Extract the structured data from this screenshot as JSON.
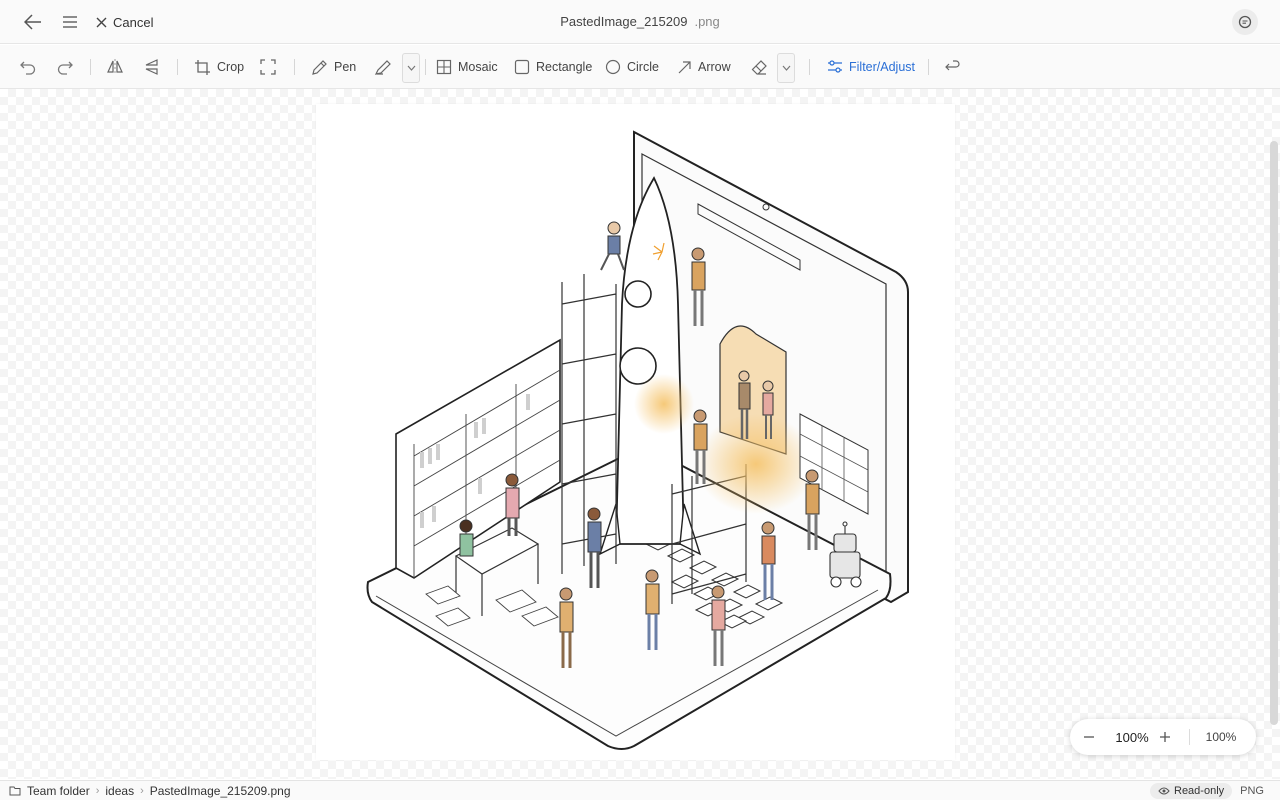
{
  "titlebar": {
    "cancel_label": "Cancel",
    "file_name": "PastedImage_215209",
    "file_ext": ".png"
  },
  "toolbar": {
    "crop": "Crop",
    "pen": "Pen",
    "mosaic": "Mosaic",
    "rectangle": "Rectangle",
    "circle": "Circle",
    "arrow": "Arrow",
    "filter": "Filter/Adjust"
  },
  "zoom": {
    "minus": "−",
    "value": "100%",
    "plus": "+",
    "fit": "100%"
  },
  "status": {
    "breadcrumb": [
      "Team folder",
      "ideas",
      "PastedImage_215209.png"
    ],
    "readonly": "Read-only",
    "format": "PNG"
  },
  "colors": {
    "accent": "#2a6fd6"
  }
}
